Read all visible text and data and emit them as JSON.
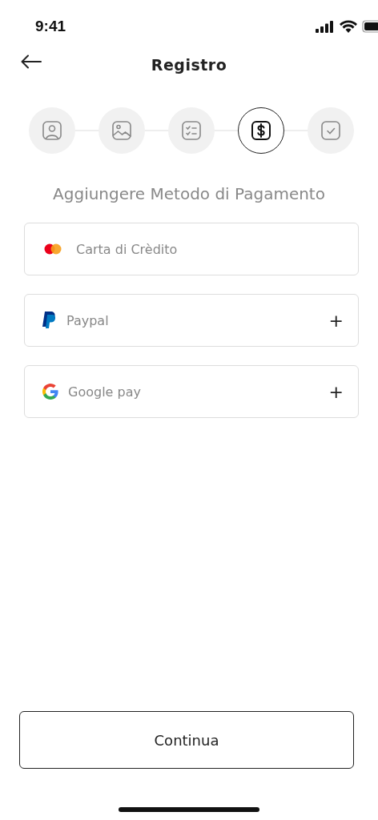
{
  "status_bar": {
    "time": "9:41"
  },
  "header": {
    "title": "Registro"
  },
  "steps": [
    {
      "kind": "profile",
      "selected": false
    },
    {
      "kind": "image",
      "selected": false
    },
    {
      "kind": "checklist",
      "selected": false
    },
    {
      "kind": "payment",
      "selected": true
    },
    {
      "kind": "done",
      "selected": false
    }
  ],
  "heading": "Aggiungere Metodo di Pagamento",
  "methods": [
    {
      "kind": "card",
      "label": "Carta di Crèdito"
    },
    {
      "kind": "paypal",
      "label": "Paypal",
      "action": "+"
    },
    {
      "kind": "google",
      "label": "Google pay",
      "action": "+"
    }
  ],
  "continue_button": "Continua"
}
